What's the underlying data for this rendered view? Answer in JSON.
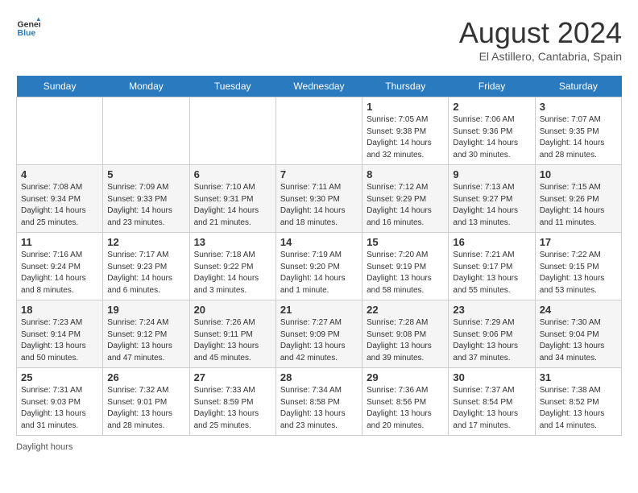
{
  "header": {
    "logo_general": "General",
    "logo_blue": "Blue",
    "month_title": "August 2024",
    "location": "El Astillero, Cantabria, Spain"
  },
  "footer": {
    "daylight_label": "Daylight hours"
  },
  "weekdays": [
    "Sunday",
    "Monday",
    "Tuesday",
    "Wednesday",
    "Thursday",
    "Friday",
    "Saturday"
  ],
  "weeks": [
    [
      {
        "date": "",
        "content": ""
      },
      {
        "date": "",
        "content": ""
      },
      {
        "date": "",
        "content": ""
      },
      {
        "date": "",
        "content": ""
      },
      {
        "date": "1",
        "content": "Sunrise: 7:05 AM\nSunset: 9:38 PM\nDaylight: 14 hours and 32 minutes."
      },
      {
        "date": "2",
        "content": "Sunrise: 7:06 AM\nSunset: 9:36 PM\nDaylight: 14 hours and 30 minutes."
      },
      {
        "date": "3",
        "content": "Sunrise: 7:07 AM\nSunset: 9:35 PM\nDaylight: 14 hours and 28 minutes."
      }
    ],
    [
      {
        "date": "4",
        "content": "Sunrise: 7:08 AM\nSunset: 9:34 PM\nDaylight: 14 hours and 25 minutes."
      },
      {
        "date": "5",
        "content": "Sunrise: 7:09 AM\nSunset: 9:33 PM\nDaylight: 14 hours and 23 minutes."
      },
      {
        "date": "6",
        "content": "Sunrise: 7:10 AM\nSunset: 9:31 PM\nDaylight: 14 hours and 21 minutes."
      },
      {
        "date": "7",
        "content": "Sunrise: 7:11 AM\nSunset: 9:30 PM\nDaylight: 14 hours and 18 minutes."
      },
      {
        "date": "8",
        "content": "Sunrise: 7:12 AM\nSunset: 9:29 PM\nDaylight: 14 hours and 16 minutes."
      },
      {
        "date": "9",
        "content": "Sunrise: 7:13 AM\nSunset: 9:27 PM\nDaylight: 14 hours and 13 minutes."
      },
      {
        "date": "10",
        "content": "Sunrise: 7:15 AM\nSunset: 9:26 PM\nDaylight: 14 hours and 11 minutes."
      }
    ],
    [
      {
        "date": "11",
        "content": "Sunrise: 7:16 AM\nSunset: 9:24 PM\nDaylight: 14 hours and 8 minutes."
      },
      {
        "date": "12",
        "content": "Sunrise: 7:17 AM\nSunset: 9:23 PM\nDaylight: 14 hours and 6 minutes."
      },
      {
        "date": "13",
        "content": "Sunrise: 7:18 AM\nSunset: 9:22 PM\nDaylight: 14 hours and 3 minutes."
      },
      {
        "date": "14",
        "content": "Sunrise: 7:19 AM\nSunset: 9:20 PM\nDaylight: 14 hours and 1 minute."
      },
      {
        "date": "15",
        "content": "Sunrise: 7:20 AM\nSunset: 9:19 PM\nDaylight: 13 hours and 58 minutes."
      },
      {
        "date": "16",
        "content": "Sunrise: 7:21 AM\nSunset: 9:17 PM\nDaylight: 13 hours and 55 minutes."
      },
      {
        "date": "17",
        "content": "Sunrise: 7:22 AM\nSunset: 9:15 PM\nDaylight: 13 hours and 53 minutes."
      }
    ],
    [
      {
        "date": "18",
        "content": "Sunrise: 7:23 AM\nSunset: 9:14 PM\nDaylight: 13 hours and 50 minutes."
      },
      {
        "date": "19",
        "content": "Sunrise: 7:24 AM\nSunset: 9:12 PM\nDaylight: 13 hours and 47 minutes."
      },
      {
        "date": "20",
        "content": "Sunrise: 7:26 AM\nSunset: 9:11 PM\nDaylight: 13 hours and 45 minutes."
      },
      {
        "date": "21",
        "content": "Sunrise: 7:27 AM\nSunset: 9:09 PM\nDaylight: 13 hours and 42 minutes."
      },
      {
        "date": "22",
        "content": "Sunrise: 7:28 AM\nSunset: 9:08 PM\nDaylight: 13 hours and 39 minutes."
      },
      {
        "date": "23",
        "content": "Sunrise: 7:29 AM\nSunset: 9:06 PM\nDaylight: 13 hours and 37 minutes."
      },
      {
        "date": "24",
        "content": "Sunrise: 7:30 AM\nSunset: 9:04 PM\nDaylight: 13 hours and 34 minutes."
      }
    ],
    [
      {
        "date": "25",
        "content": "Sunrise: 7:31 AM\nSunset: 9:03 PM\nDaylight: 13 hours and 31 minutes."
      },
      {
        "date": "26",
        "content": "Sunrise: 7:32 AM\nSunset: 9:01 PM\nDaylight: 13 hours and 28 minutes."
      },
      {
        "date": "27",
        "content": "Sunrise: 7:33 AM\nSunset: 8:59 PM\nDaylight: 13 hours and 25 minutes."
      },
      {
        "date": "28",
        "content": "Sunrise: 7:34 AM\nSunset: 8:58 PM\nDaylight: 13 hours and 23 minutes."
      },
      {
        "date": "29",
        "content": "Sunrise: 7:36 AM\nSunset: 8:56 PM\nDaylight: 13 hours and 20 minutes."
      },
      {
        "date": "30",
        "content": "Sunrise: 7:37 AM\nSunset: 8:54 PM\nDaylight: 13 hours and 17 minutes."
      },
      {
        "date": "31",
        "content": "Sunrise: 7:38 AM\nSunset: 8:52 PM\nDaylight: 13 hours and 14 minutes."
      }
    ]
  ]
}
